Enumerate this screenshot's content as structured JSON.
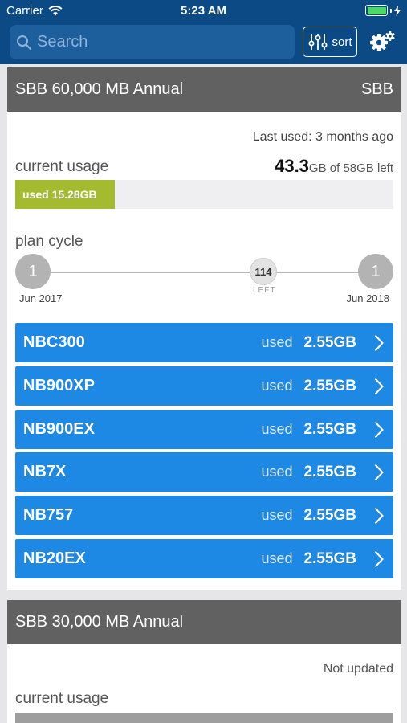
{
  "status_bar": {
    "carrier": "Carrier",
    "time": "5:23 AM"
  },
  "search": {
    "placeholder": "Search"
  },
  "toolbar": {
    "sort_label": "sort"
  },
  "plans": [
    {
      "title": "SBB 60,000 MB Annual",
      "provider": "SBB",
      "last_used": "Last used: 3 months ago",
      "current_usage_label": "current usage",
      "left_value": "43.3",
      "left_unit": "GB",
      "left_suffix": "of 58GB left",
      "used_label": "used 15.28GB",
      "used_fraction": 0.263,
      "plan_cycle_label": "plan cycle",
      "cycle_start_day": "1",
      "cycle_end_day": "1",
      "days_left": "114",
      "days_left_label": "LEFT",
      "cycle_start_date": "Jun 2017",
      "cycle_end_date": "Jun 2018",
      "devices": [
        {
          "name": "NBC300",
          "used_label": "used",
          "used_amount": "2.55GB"
        },
        {
          "name": "NB900XP",
          "used_label": "used",
          "used_amount": "2.55GB"
        },
        {
          "name": "NB900EX",
          "used_label": "used",
          "used_amount": "2.55GB"
        },
        {
          "name": "NB7X",
          "used_label": "used",
          "used_amount": "2.55GB"
        },
        {
          "name": "NB757",
          "used_label": "used",
          "used_amount": "2.55GB"
        },
        {
          "name": "NB20EX",
          "used_label": "used",
          "used_amount": "2.55GB"
        }
      ]
    },
    {
      "title": "SBB 30,000 MB Annual",
      "status_text": "Not updated",
      "current_usage_label": "current usage"
    }
  ],
  "colors": {
    "nav_bg": "#0c4a86",
    "device_row": "#1e88e5",
    "usage_fill": "#a4bb2f",
    "card_header": "#616161"
  }
}
